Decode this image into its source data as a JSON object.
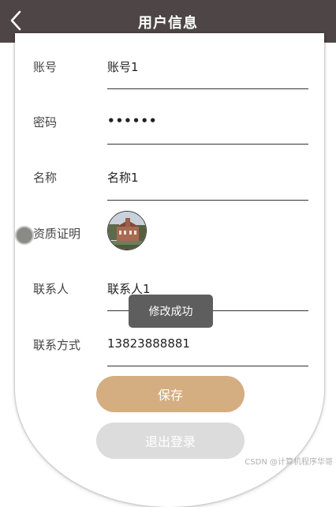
{
  "header": {
    "back_icon": "chevron-left-icon",
    "title": "用户信息",
    "background": "#4e4646"
  },
  "form": {
    "account_label": "账号",
    "account_value": "账号1",
    "password_label": "密码",
    "password_value": "••••••",
    "name_label": "名称",
    "name_value": "名称1",
    "credential_label": "资质证明",
    "credential_image": "building-photo-thumbnail",
    "contact_label": "联系人",
    "contact_value": "联系人1",
    "phone_label": "联系方式",
    "phone_value": "13823888881"
  },
  "buttons": {
    "save_label": "保存",
    "save_color": "#d4ad81",
    "logout_label": "退出登录",
    "logout_color": "#dcdcdc"
  },
  "toast": {
    "message": "修改成功"
  },
  "watermark": "CSDN @计算机程序华哥"
}
